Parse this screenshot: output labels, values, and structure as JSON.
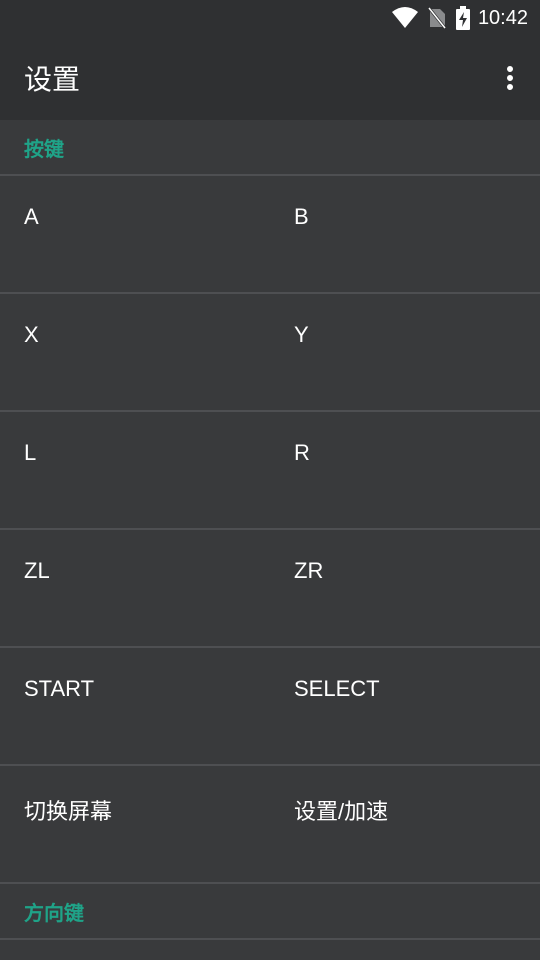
{
  "status_bar": {
    "time": "10:42",
    "icons": [
      "wifi-icon",
      "no-sim-icon",
      "battery-charging-icon"
    ]
  },
  "app_bar": {
    "title": "设置",
    "menu_icon": "more-vert-icon"
  },
  "sections": [
    {
      "header": "按键",
      "rows": [
        {
          "left": "A",
          "right": "B"
        },
        {
          "left": "X",
          "right": "Y"
        },
        {
          "left": "L",
          "right": "R"
        },
        {
          "left": "ZL",
          "right": "ZR"
        },
        {
          "left": "START",
          "right": "SELECT"
        },
        {
          "left": "切换屏幕",
          "right": "设置/加速"
        }
      ]
    },
    {
      "header": "方向键",
      "rows": []
    }
  ],
  "colors": {
    "background": "#393a3c",
    "toolbar": "#2f3032",
    "accent": "#1fa388",
    "divider": "#4e4f52"
  }
}
